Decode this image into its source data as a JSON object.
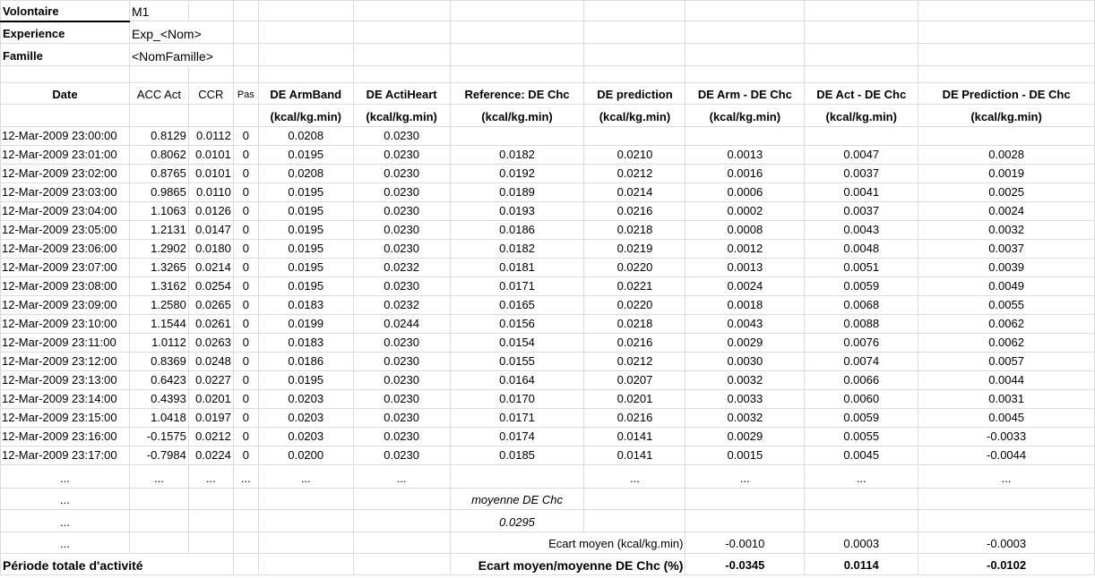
{
  "meta": {
    "volontaire_label": "Volontaire",
    "volontaire_value": "M1",
    "experience_label": "Experience",
    "experience_value": "Exp_<Nom>",
    "famille_label": "Famille",
    "famille_value": "<NomFamille>"
  },
  "headers": {
    "date": "Date",
    "acc": "ACC Act",
    "ccr": "CCR",
    "pas": "Pas",
    "armband": "DE ArmBand",
    "actiheart": "DE ActiHeart",
    "reference": "Reference: DE Chc",
    "prediction": "DE prediction",
    "arm_diff": "DE Arm - DE Chc",
    "act_diff": "DE Act - DE Chc",
    "pred_diff": "DE Prediction - DE Chc",
    "unit": "(kcal/kg.min)"
  },
  "rows": [
    [
      "12-Mar-2009 23:00:00",
      "0.8129",
      "0.0112",
      "0",
      "0.0208",
      "0.0230",
      "",
      "",
      "",
      "",
      ""
    ],
    [
      "12-Mar-2009 23:01:00",
      "0.8062",
      "0.0101",
      "0",
      "0.0195",
      "0.0230",
      "0.0182",
      "0.0210",
      "0.0013",
      "0.0047",
      "0.0028"
    ],
    [
      "12-Mar-2009 23:02:00",
      "0.8765",
      "0.0101",
      "0",
      "0.0208",
      "0.0230",
      "0.0192",
      "0.0212",
      "0.0016",
      "0.0037",
      "0.0019"
    ],
    [
      "12-Mar-2009 23:03:00",
      "0.9865",
      "0.0110",
      "0",
      "0.0195",
      "0.0230",
      "0.0189",
      "0.0214",
      "0.0006",
      "0.0041",
      "0.0025"
    ],
    [
      "12-Mar-2009 23:04:00",
      "1.1063",
      "0.0126",
      "0",
      "0.0195",
      "0.0230",
      "0.0193",
      "0.0216",
      "0.0002",
      "0.0037",
      "0.0024"
    ],
    [
      "12-Mar-2009 23:05:00",
      "1.2131",
      "0.0147",
      "0",
      "0.0195",
      "0.0230",
      "0.0186",
      "0.0218",
      "0.0008",
      "0.0043",
      "0.0032"
    ],
    [
      "12-Mar-2009 23:06:00",
      "1.2902",
      "0.0180",
      "0",
      "0.0195",
      "0.0230",
      "0.0182",
      "0.0219",
      "0.0012",
      "0.0048",
      "0.0037"
    ],
    [
      "12-Mar-2009 23:07:00",
      "1.3265",
      "0.0214",
      "0",
      "0.0195",
      "0.0232",
      "0.0181",
      "0.0220",
      "0.0013",
      "0.0051",
      "0.0039"
    ],
    [
      "12-Mar-2009 23:08:00",
      "1.3162",
      "0.0254",
      "0",
      "0.0195",
      "0.0230",
      "0.0171",
      "0.0221",
      "0.0024",
      "0.0059",
      "0.0049"
    ],
    [
      "12-Mar-2009 23:09:00",
      "1.2580",
      "0.0265",
      "0",
      "0.0183",
      "0.0232",
      "0.0165",
      "0.0220",
      "0.0018",
      "0.0068",
      "0.0055"
    ],
    [
      "12-Mar-2009 23:10:00",
      "1.1544",
      "0.0261",
      "0",
      "0.0199",
      "0.0244",
      "0.0156",
      "0.0218",
      "0.0043",
      "0.0088",
      "0.0062"
    ],
    [
      "12-Mar-2009 23:11:00",
      "1.0112",
      "0.0263",
      "0",
      "0.0183",
      "0.0230",
      "0.0154",
      "0.0216",
      "0.0029",
      "0.0076",
      "0.0062"
    ],
    [
      "12-Mar-2009 23:12:00",
      "0.8369",
      "0.0248",
      "0",
      "0.0186",
      "0.0230",
      "0.0155",
      "0.0212",
      "0.0030",
      "0.0074",
      "0.0057"
    ],
    [
      "12-Mar-2009 23:13:00",
      "0.6423",
      "0.0227",
      "0",
      "0.0195",
      "0.0230",
      "0.0164",
      "0.0207",
      "0.0032",
      "0.0066",
      "0.0044"
    ],
    [
      "12-Mar-2009 23:14:00",
      "0.4393",
      "0.0201",
      "0",
      "0.0203",
      "0.0230",
      "0.0170",
      "0.0201",
      "0.0033",
      "0.0060",
      "0.0031"
    ],
    [
      "12-Mar-2009 23:15:00",
      "1.0418",
      "0.0197",
      "0",
      "0.0203",
      "0.0230",
      "0.0171",
      "0.0216",
      "0.0032",
      "0.0059",
      "0.0045"
    ],
    [
      "12-Mar-2009 23:16:00",
      "-0.1575",
      "0.0212",
      "0",
      "0.0203",
      "0.0230",
      "0.0174",
      "0.0141",
      "0.0029",
      "0.0055",
      "-0.0033"
    ],
    [
      "12-Mar-2009 23:17:00",
      "-0.7984",
      "0.0224",
      "0",
      "0.0200",
      "0.0230",
      "0.0185",
      "0.0141",
      "0.0015",
      "0.0045",
      "-0.0044"
    ]
  ],
  "ellipsis": "...",
  "summary": {
    "moyenne_label": "moyenne DE Chc",
    "moyenne_value": "0.0295",
    "ecart_label": "Ecart moyen (kcal/kg.min)",
    "ecart_arm": "-0.0010",
    "ecart_act": "0.0003",
    "ecart_pred": "-0.0003",
    "periode_label": "Période totale d'activité",
    "ratio_label": "Ecart moyen/moyenne DE Chc  (%)",
    "ratio_arm": "-0.0345",
    "ratio_act": "0.0114",
    "ratio_pred": "-0.0102"
  }
}
